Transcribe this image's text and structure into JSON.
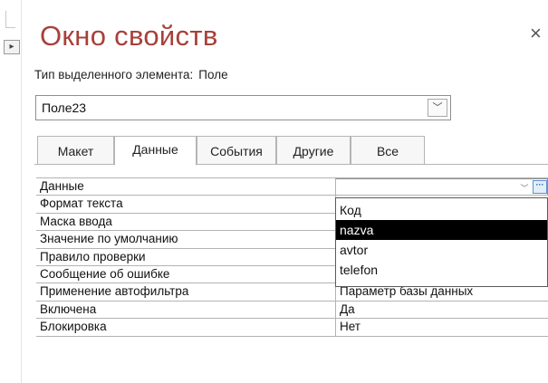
{
  "window": {
    "title": "Окно свойств",
    "close_symbol": "×"
  },
  "selection": {
    "type_label": "Тип выделенного элемента:",
    "type_value": "Поле",
    "object_name": "Поле23"
  },
  "tabs": [
    {
      "label": "Макет",
      "active": false
    },
    {
      "label": "Данные",
      "active": true
    },
    {
      "label": "События",
      "active": false
    },
    {
      "label": "Другие",
      "active": false
    },
    {
      "label": "Все",
      "active": false
    }
  ],
  "properties": [
    {
      "name": "Данные",
      "value": ""
    },
    {
      "name": "Формат текста",
      "value": ""
    },
    {
      "name": "Маска ввода",
      "value": ""
    },
    {
      "name": "Значение по умолчанию",
      "value": ""
    },
    {
      "name": "Правило проверки",
      "value": ""
    },
    {
      "name": "Сообщение об ошибке",
      "value": ""
    },
    {
      "name": "Применение автофильтра",
      "value": "Параметр базы данных"
    },
    {
      "name": "Включена",
      "value": "Да"
    },
    {
      "name": "Блокировка",
      "value": "Нет"
    }
  ],
  "dropdown": {
    "options": [
      "Код",
      "nazva",
      "avtor",
      "telefon"
    ],
    "selected": "nazva"
  },
  "icons": {
    "combo_arrow": "chevron-down-icon",
    "builder": "ellipsis-builder-icon",
    "close": "close-icon"
  },
  "colors": {
    "title": "#a8403a",
    "selected_bg": "#000000",
    "selected_fg": "#ffffff"
  }
}
